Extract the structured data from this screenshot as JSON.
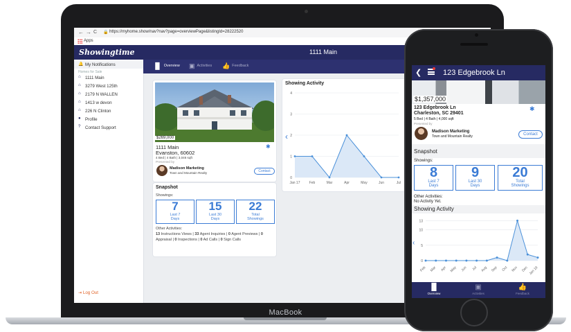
{
  "laptop": {
    "brand": "MacBook",
    "browser": {
      "back": "←",
      "forward": "→",
      "reload": "C",
      "url": "https://myhome.show/nav?nav?page=overviewPage&listingId=28222520",
      "bookmark_apps": "Apps"
    },
    "app": {
      "logo": "Showingtime",
      "title": "1111 Main",
      "sidebar": {
        "items": [
          {
            "icon": "bell-icon",
            "label": "My Notifications"
          },
          {
            "icon": "home-icon",
            "label": "1111 Main"
          },
          {
            "icon": "home-icon",
            "label": "3279 West 125th"
          },
          {
            "icon": "home-icon",
            "label": "2179 N WALLEN"
          },
          {
            "icon": "home-icon",
            "label": "1413 w devon"
          },
          {
            "icon": "home-icon",
            "label": "226 N Clinton"
          },
          {
            "icon": "person-icon",
            "label": "Profile"
          },
          {
            "icon": "help-icon",
            "label": "Contact Support"
          }
        ],
        "section_label": "Homes for Sale",
        "logout": "Log Out"
      },
      "tabs": [
        {
          "label": "Overview",
          "icon": "bar-chart-icon"
        },
        {
          "label": "Activities",
          "icon": "calendar-icon"
        },
        {
          "label": "Feedback",
          "icon": "thumbs-up-icon"
        }
      ],
      "property": {
        "price": "$269,000",
        "name": "1111 Main",
        "city": "Evanston, 60602",
        "details": "4 Bed | 4 Bath | 3,046 sqft",
        "presented_by": "Presented by",
        "agent": "Madison Marketing",
        "agency": "Town and Mountain Realty",
        "contact": "Contact"
      },
      "snapshot": {
        "title": "Snapshot",
        "showings_label": "Showings:",
        "stats": [
          {
            "value": "7",
            "label": "Last 7 Days"
          },
          {
            "value": "15",
            "label": "Last 30 Days"
          },
          {
            "value": "22",
            "label": "Total Showings"
          }
        ],
        "other_label": "Other Activities:",
        "other_line1": [
          {
            "n": "13",
            "t": " Instructions Views | "
          },
          {
            "n": "33",
            "t": " Agent Inquiries | "
          },
          {
            "n": "0",
            "t": " Agent Previews | "
          },
          {
            "n": "0",
            "t": ""
          }
        ],
        "other_line2": [
          {
            "n": "",
            "t": "Appraisal | "
          },
          {
            "n": "0",
            "t": " Inspections | "
          },
          {
            "n": "0",
            "t": " Ad Calls | "
          },
          {
            "n": "0",
            "t": " Sign Calls"
          }
        ]
      },
      "showing_activity": {
        "title": "Showing Activity",
        "prev": "‹"
      }
    }
  },
  "phone": {
    "title": "123 Edgebrook Ln",
    "price": "$1,357,000",
    "address": "123 Edgebrook Ln",
    "city": "Charleston, SC 29401",
    "details": "5 Bed | 4 Bath | 4,000 sqft",
    "presented_by": "Presented by",
    "agent": "Madison Marketing",
    "agency": "Town and Mountain Realty",
    "contact": "Contact",
    "snapshot": "Snapshot",
    "showings_label": "Showings:",
    "stats": [
      {
        "value": "8",
        "label": "Last 7 Days"
      },
      {
        "value": "9",
        "label": "Last 30 Days"
      },
      {
        "value": "20",
        "label": "Total Showings"
      }
    ],
    "other_label": "Other Activities:",
    "other_value": "No Activity Yet.",
    "showing_activity": "Showing Activity",
    "tabs": [
      {
        "label": "Overview",
        "icon": "bar-chart-icon"
      },
      {
        "label": "Activities",
        "icon": "calendar-icon"
      },
      {
        "label": "Feedback",
        "icon": "thumbs-up-icon"
      }
    ]
  },
  "chart_data": [
    {
      "type": "area",
      "title": "Showing Activity",
      "categories": [
        "Jan 17",
        "Feb",
        "Mar",
        "Apr",
        "May",
        "Jun",
        "Jul"
      ],
      "values": [
        1,
        1,
        0,
        2,
        1,
        0,
        0
      ],
      "yticks": [
        0,
        1,
        2,
        3,
        4
      ],
      "ylim": [
        0,
        4
      ],
      "grid": true,
      "color": "#4a90d9"
    },
    {
      "type": "area",
      "title": "Showing Activity",
      "categories": [
        "Feb",
        "Mar",
        "Apr",
        "May",
        "Jun",
        "Jul",
        "Aug",
        "Sep",
        "Oct",
        "Nov",
        "Dec",
        "Jan 19"
      ],
      "values": [
        0,
        0,
        0,
        0,
        0,
        0,
        0,
        1,
        0,
        13,
        2,
        1
      ],
      "yticks": [
        0,
        5,
        10,
        13
      ],
      "ylim": [
        0,
        14
      ],
      "grid": true,
      "color": "#4a90d9"
    }
  ]
}
